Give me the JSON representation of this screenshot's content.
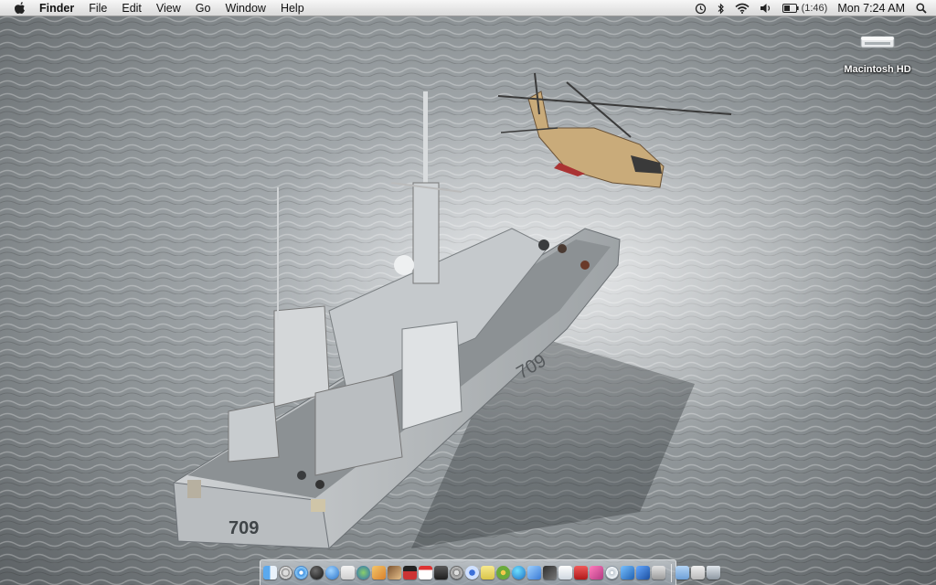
{
  "menubar": {
    "app_name": "Finder",
    "menus": [
      "File",
      "Edit",
      "View",
      "Go",
      "Window",
      "Help"
    ],
    "battery_time": "(1:46)",
    "clock": "Mon 7:24 AM",
    "status_icons": [
      "time-machine-icon",
      "bluetooth-icon",
      "wifi-icon",
      "volume-icon",
      "battery-icon",
      "spotlight-icon"
    ]
  },
  "desktop": {
    "hd_label": "Macintosh HD",
    "hull_numbers": [
      "709",
      "709"
    ]
  },
  "dock": {
    "apps": [
      "finder",
      "compass",
      "safari",
      "ball",
      "chat",
      "mail",
      "web",
      "photo",
      "guitar",
      "clap",
      "cal",
      "photobooth",
      "gear",
      "itunes",
      "notes",
      "flower",
      "globe",
      "plane",
      "dash",
      "doc",
      "red",
      "pink",
      "cd",
      "bird",
      "cube",
      "gray"
    ],
    "right": [
      "folder",
      "docs",
      "trash"
    ]
  }
}
